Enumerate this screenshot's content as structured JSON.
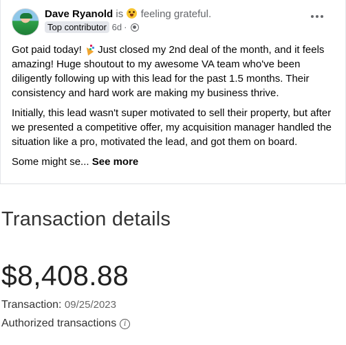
{
  "post": {
    "author": "Dave Ryanold",
    "is_text": "is",
    "feeling_text": "feeling grateful.",
    "badge": "Top contributor",
    "time": "6d",
    "separator": "·",
    "paragraph1_a": "Got paid today!",
    "paragraph1_b": "Just closed my 2nd deal of the month, and it feels amazing! Huge shoutout to my awesome VA team who've been diligently following up with this lead for the past 1.5 months. Their consistency and hard work are making my business thrive.",
    "paragraph2": "Initially, this lead wasn't super motivated to sell their property, but after we presented a competitive offer, my acquisition manager handled the situation like a pro, motivated the lead, and got them on board.",
    "paragraph3": "Some might se...",
    "see_more": "See more",
    "icons": [
      "avatar",
      "grinning-face-icon",
      "globe-icon",
      "more-options-icon",
      "party-popper-icon"
    ]
  },
  "transaction": {
    "title": "Transaction details",
    "amount": "$8,408.88",
    "label": "Transaction:",
    "date": "09/25/2023",
    "authorized": "Authorized transactions",
    "info_glyph": "i"
  }
}
